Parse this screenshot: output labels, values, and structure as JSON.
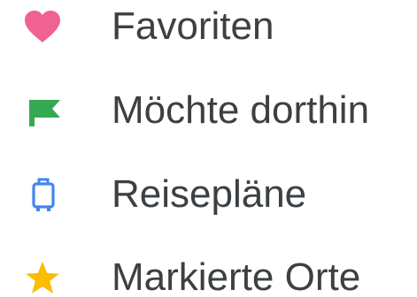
{
  "lists": [
    {
      "label": "Favoriten",
      "icon": "heart-icon",
      "color": "#f06292"
    },
    {
      "label": "Möchte dorthin",
      "icon": "flag-icon",
      "color": "#34a853"
    },
    {
      "label": "Reisepläne",
      "icon": "suitcase-icon",
      "color": "#4285f4"
    },
    {
      "label": "Markierte Orte",
      "icon": "star-icon",
      "color": "#fbbc04"
    }
  ]
}
